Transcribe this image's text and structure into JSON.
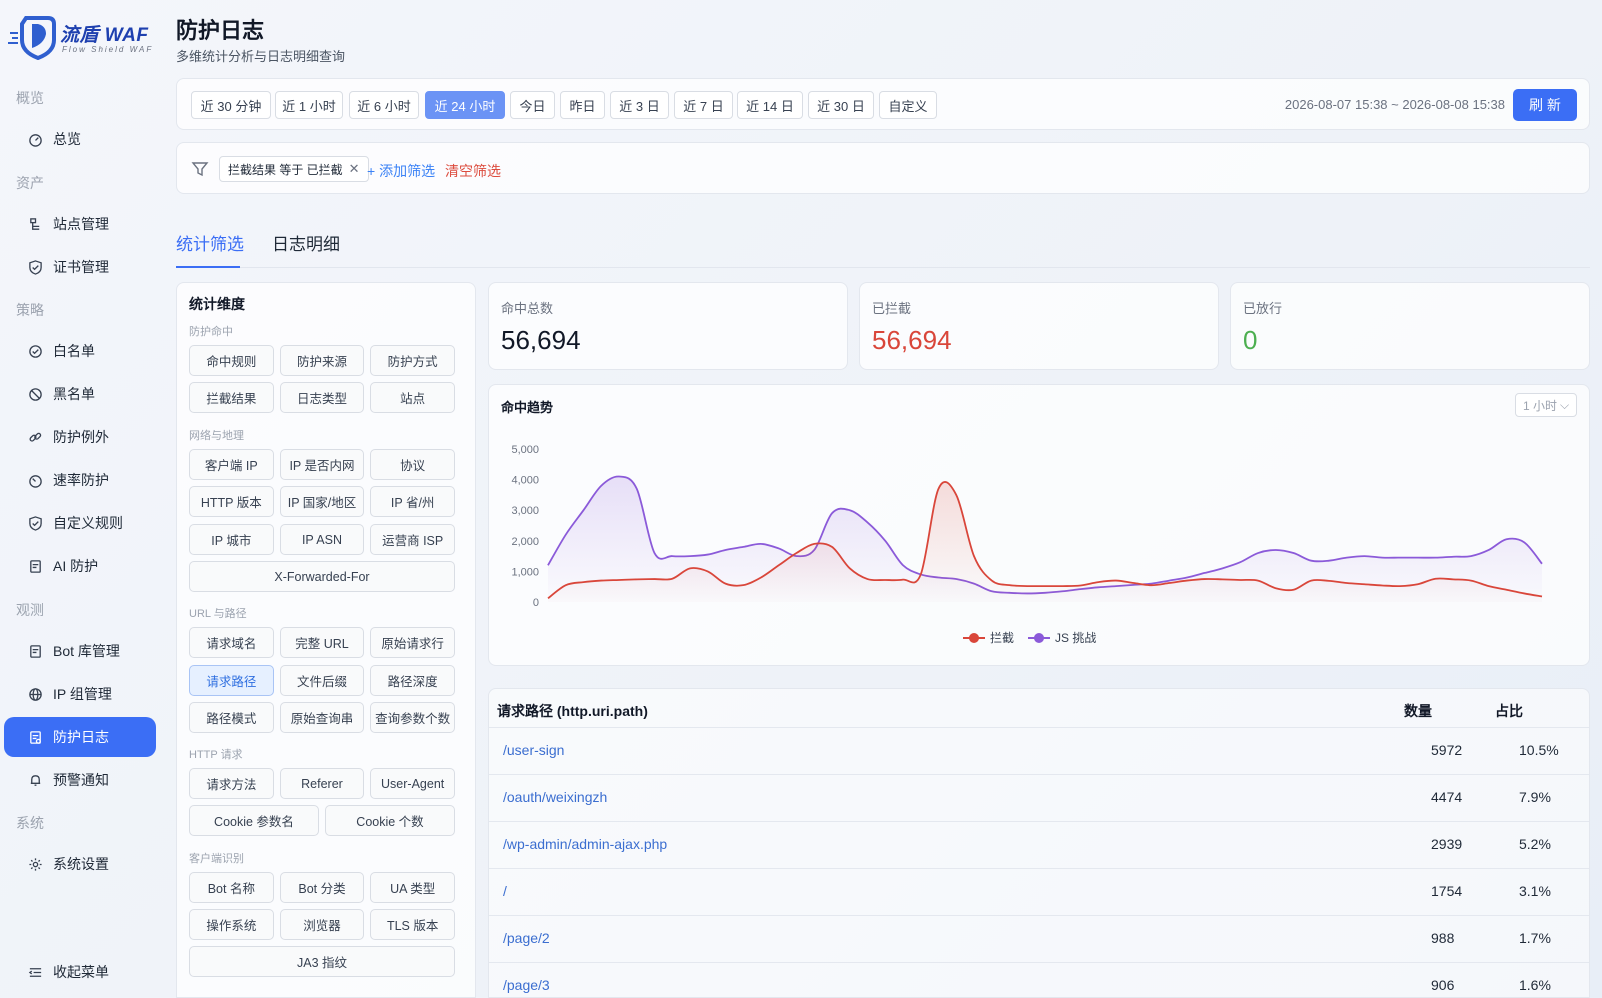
{
  "brand": {
    "name": "流盾 WAF",
    "tagline": "Flow Shield WAF"
  },
  "sidebar": {
    "groups": [
      {
        "label": "概览",
        "items": [
          {
            "label": "总览",
            "icon": "dashboard-icon"
          }
        ]
      },
      {
        "label": "资产",
        "items": [
          {
            "label": "站点管理",
            "icon": "sitemap-icon"
          },
          {
            "label": "证书管理",
            "icon": "shield-check-icon"
          }
        ]
      },
      {
        "label": "策略",
        "items": [
          {
            "label": "白名单",
            "icon": "check-circle-icon"
          },
          {
            "label": "黑名单",
            "icon": "ban-icon"
          },
          {
            "label": "防护例外",
            "icon": "link-icon"
          },
          {
            "label": "速率防护",
            "icon": "gauge-icon"
          },
          {
            "label": "自定义规则",
            "icon": "shield-check-icon"
          },
          {
            "label": "AI 防护",
            "icon": "robot-icon"
          }
        ]
      },
      {
        "label": "观测",
        "items": [
          {
            "label": "Bot 库管理",
            "icon": "robot-icon"
          },
          {
            "label": "IP 组管理",
            "icon": "globe-icon"
          },
          {
            "label": "防护日志",
            "icon": "log-icon",
            "active": true
          },
          {
            "label": "预警通知",
            "icon": "bell-icon"
          }
        ]
      },
      {
        "label": "系统",
        "items": [
          {
            "label": "系统设置",
            "icon": "gear-icon"
          }
        ]
      }
    ],
    "collapse_label": "收起菜单"
  },
  "header": {
    "title": "防护日志",
    "subtitle": "多维统计分析与日志明细查询"
  },
  "time_bar": {
    "options": [
      "近 30 分钟",
      "近 1 小时",
      "近 6 小时",
      "近 24 小时",
      "今日",
      "昨日",
      "近 3 日",
      "近 7 日",
      "近 14 日",
      "近 30 日",
      "自定义"
    ],
    "selected": "近 24 小时",
    "range": "2026-08-07 15:38 ~ 2026-08-08 15:38",
    "refresh_label": "刷 新"
  },
  "filters": {
    "chip": "拦截结果 等于 已拦截",
    "add_label": "+ 添加筛选",
    "clear_label": "清空筛选"
  },
  "tabs": [
    {
      "label": "统计筛选",
      "active": true
    },
    {
      "label": "日志明细"
    }
  ],
  "dimensions": {
    "title": "统计维度",
    "sections": [
      {
        "label": "防护命中",
        "rows": [
          [
            "命中规则",
            "防护来源",
            "防护方式"
          ],
          [
            "拦截结果",
            "日志类型",
            "站点"
          ]
        ]
      },
      {
        "label": "网络与地理",
        "rows": [
          [
            "客户端 IP",
            "IP 是否内网",
            "协议"
          ],
          [
            "HTTP 版本",
            "IP 国家/地区",
            "IP 省/州"
          ],
          [
            "IP 城市",
            "IP ASN",
            "运营商 ISP"
          ],
          [
            "X-Forwarded-For"
          ]
        ]
      },
      {
        "label": "URL 与路径",
        "rows": [
          [
            "请求域名",
            "完整 URL",
            "原始请求行"
          ],
          [
            "请求路径",
            "文件后缀",
            "路径深度"
          ],
          [
            "路径模式",
            "原始查询串",
            "查询参数个数"
          ]
        ]
      },
      {
        "label": "HTTP 请求",
        "rows": [
          [
            "请求方法",
            "Referer",
            "User-Agent"
          ],
          [
            "Cookie 参数名",
            "Cookie 个数"
          ]
        ]
      },
      {
        "label": "客户端识别",
        "rows": [
          [
            "Bot 名称",
            "Bot 分类",
            "UA 类型"
          ],
          [
            "操作系统",
            "浏览器",
            "TLS 版本"
          ],
          [
            "JA3 指纹"
          ]
        ]
      }
    ],
    "selected": "请求路径"
  },
  "stats": [
    {
      "label": "命中总数",
      "value": "56,694",
      "color": "#111827"
    },
    {
      "label": "已拦截",
      "value": "56,694",
      "color": "#d9463a"
    },
    {
      "label": "已放行",
      "value": "0",
      "color": "#4caf50"
    }
  ],
  "trend": {
    "title": "命中趋势",
    "interval": "1 小时"
  },
  "chart_data": {
    "type": "area",
    "title": "命中趋势",
    "ylim": [
      0,
      5000
    ],
    "yticks": [
      "0",
      "1,000",
      "2,000",
      "3,000",
      "4,000",
      "5,000"
    ],
    "legend_position": "bottom",
    "series": [
      {
        "name": "拦截",
        "color": "#d9463a",
        "values": [
          120,
          550,
          650,
          700,
          720,
          740,
          750,
          760,
          1100,
          1000,
          600,
          550,
          800,
          1200,
          1600,
          1900,
          1800,
          1100,
          750,
          720,
          730,
          900,
          3700,
          3500,
          1500,
          700,
          550,
          520,
          520,
          520,
          540,
          650,
          700,
          620,
          550,
          620,
          700,
          750,
          740,
          720,
          700,
          450,
          400,
          700,
          690,
          620,
          580,
          540,
          520,
          580,
          760,
          740,
          700,
          520,
          400,
          280,
          180
        ]
      },
      {
        "name": "JS 挑战",
        "color": "#8b5ad9",
        "values": [
          1200,
          2200,
          3000,
          3800,
          4100,
          3700,
          1600,
          1500,
          1500,
          1550,
          1700,
          1800,
          1900,
          1750,
          1500,
          1700,
          2900,
          3000,
          2600,
          2000,
          1200,
          900,
          800,
          750,
          600,
          350,
          300,
          280,
          300,
          350,
          420,
          480,
          520,
          560,
          600,
          700,
          800,
          950,
          1100,
          1300,
          1600,
          1700,
          1600,
          1350,
          1350,
          1450,
          1500,
          1450,
          1450,
          1450,
          1450,
          1480,
          1500,
          1700,
          2050,
          1950,
          1250
        ]
      }
    ]
  },
  "table": {
    "columns": [
      "请求路径 (http.uri.path)",
      "数量",
      "占比"
    ],
    "rows": [
      [
        "/user-sign",
        "5972",
        "10.5%"
      ],
      [
        "/oauth/weixingzh",
        "4474",
        "7.9%"
      ],
      [
        "/wp-admin/admin-ajax.php",
        "2939",
        "5.2%"
      ],
      [
        "/",
        "1754",
        "3.1%"
      ],
      [
        "/page/2",
        "988",
        "1.7%"
      ],
      [
        "/page/3",
        "906",
        "1.6%"
      ]
    ]
  }
}
